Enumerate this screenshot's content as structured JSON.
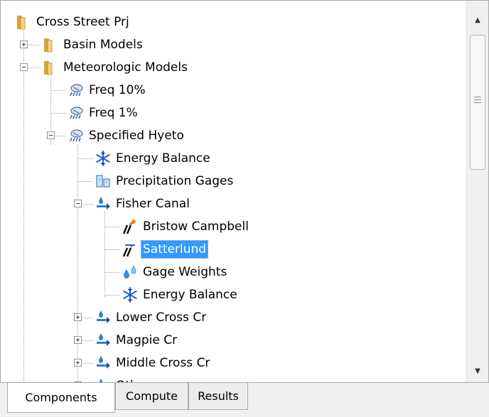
{
  "tree": {
    "items": [
      {
        "label": "Cross Street Prj",
        "icon": "folder-icon"
      },
      {
        "label": "Basin Models",
        "icon": "folder-icon"
      },
      {
        "label": "Meteorologic Models",
        "icon": "folder-icon"
      },
      {
        "label": "Freq 10%",
        "icon": "meteorologic-model-icon"
      },
      {
        "label": "Freq 1%",
        "icon": "meteorologic-model-icon"
      },
      {
        "label": "Specified Hyeto",
        "icon": "meteorologic-model-icon"
      },
      {
        "label": "Energy Balance",
        "icon": "snowflake-icon"
      },
      {
        "label": "Precipitation Gages",
        "icon": "precipitation-gages-icon"
      },
      {
        "label": "Fisher Canal",
        "icon": "subbasin-icon"
      },
      {
        "label": "Bristow Campbell",
        "icon": "evapotranspiration-icon"
      },
      {
        "label": "Satterlund",
        "icon": "evapotranspiration-icon",
        "selected": true
      },
      {
        "label": "Gage Weights",
        "icon": "water-drops-icon"
      },
      {
        "label": "Energy Balance",
        "icon": "snowflake-icon"
      },
      {
        "label": "Lower Cross Cr",
        "icon": "subbasin-icon"
      },
      {
        "label": "Magpie Cr",
        "icon": "subbasin-icon"
      },
      {
        "label": "Middle Cross Cr",
        "icon": "subbasin-icon"
      },
      {
        "label": "Other",
        "icon": "subbasin-icon"
      }
    ]
  },
  "tabs": [
    {
      "label": "Components",
      "active": true
    },
    {
      "label": "Compute",
      "active": false
    },
    {
      "label": "Results",
      "active": false
    }
  ],
  "colors": {
    "selection": "#3399ff",
    "folder": "#f2c14e"
  }
}
